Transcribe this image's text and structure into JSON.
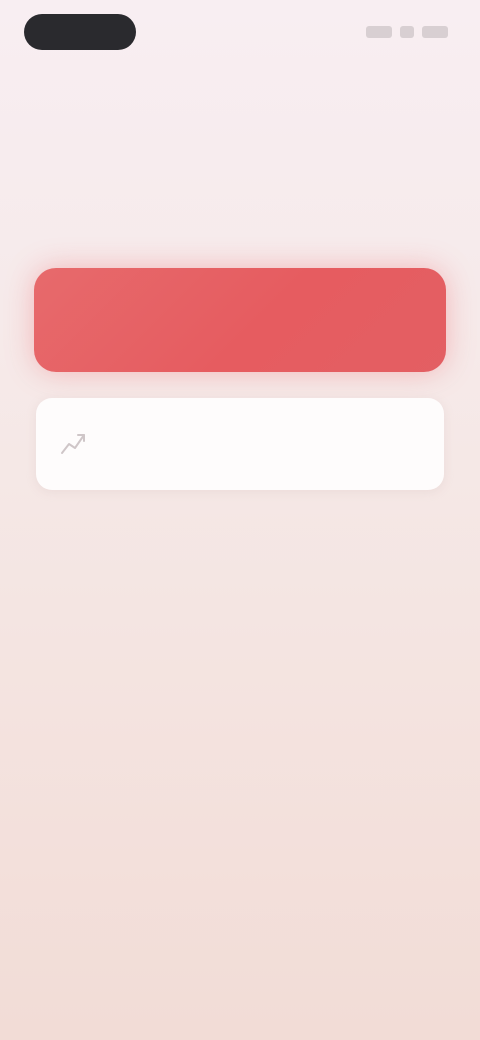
{
  "status_bar": {
    "pill_label": "",
    "right_text": ""
  },
  "breadcrumb": "",
  "heading": "",
  "subtitle": "",
  "primary_button": {
    "label": ""
  },
  "card": {
    "icon": "chart-line-icon",
    "title": "",
    "subtitle": "",
    "meta": ""
  },
  "colors": {
    "accent": "#e65c60",
    "card_background": "#fefcfc",
    "page_background_top": "#f8eef2",
    "page_background_bottom": "#f2dcd6",
    "pill_background": "#2a2a2e"
  }
}
